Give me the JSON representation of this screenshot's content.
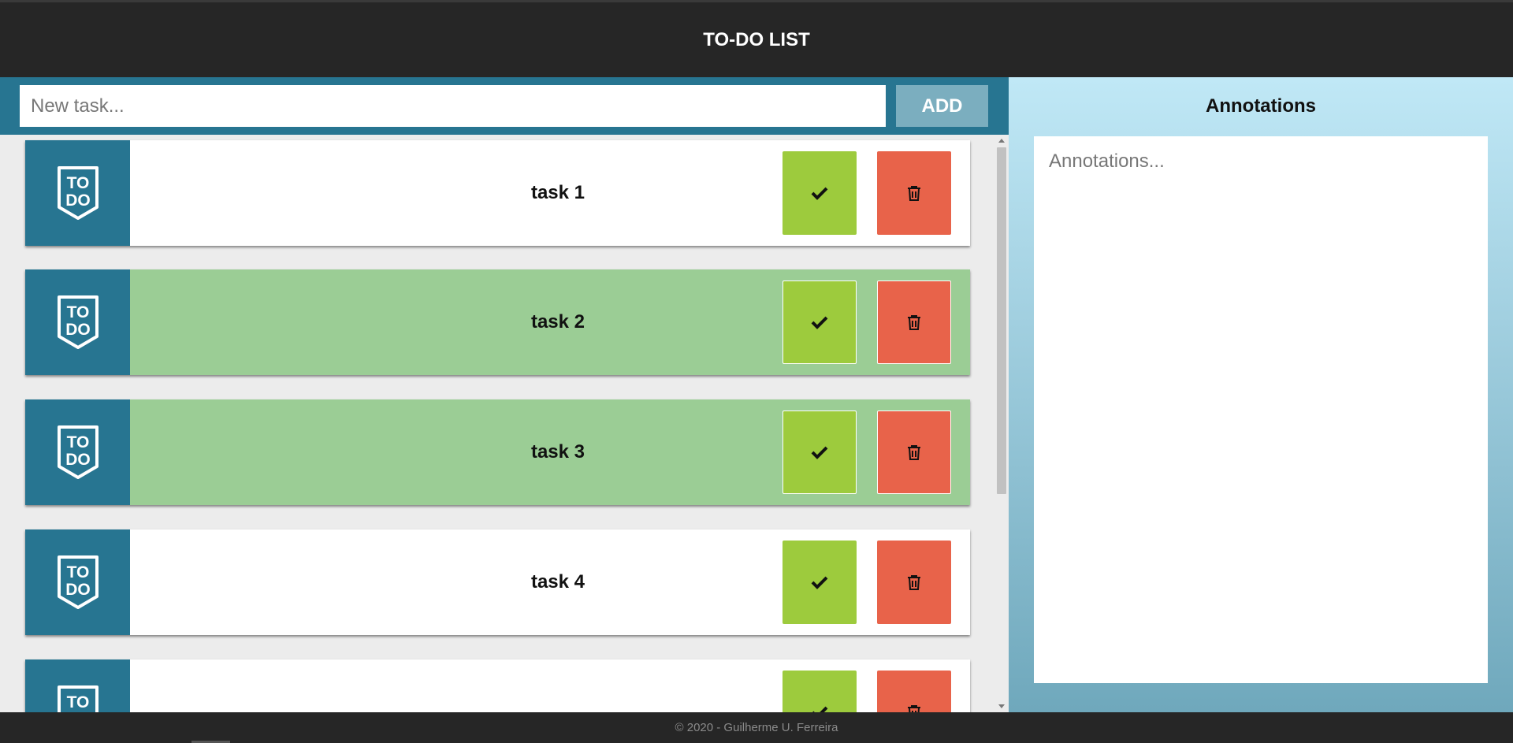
{
  "header": {
    "title": "TO-DO LIST"
  },
  "input": {
    "placeholder": "New task...",
    "add_label": "ADD"
  },
  "tasks": [
    {
      "label": "task 1",
      "done": false
    },
    {
      "label": "task 2",
      "done": true
    },
    {
      "label": "task 3",
      "done": true
    },
    {
      "label": "task 4",
      "done": false
    },
    {
      "label": "",
      "done": false
    }
  ],
  "icons": {
    "logo": "todo-shield-icon",
    "check": "checkmark-icon",
    "delete": "trash-icon"
  },
  "annotations": {
    "title": "Annotations",
    "placeholder": "Annotations..."
  },
  "footer": {
    "text": "© 2020 - Guilherme U. Ferreira"
  },
  "colors": {
    "header_bg": "#262626",
    "accent": "#277591",
    "add_button": "#7baebf",
    "done_task": "#9bcd95",
    "check_button": "#9dcb3d",
    "delete_button": "#e8634a"
  }
}
